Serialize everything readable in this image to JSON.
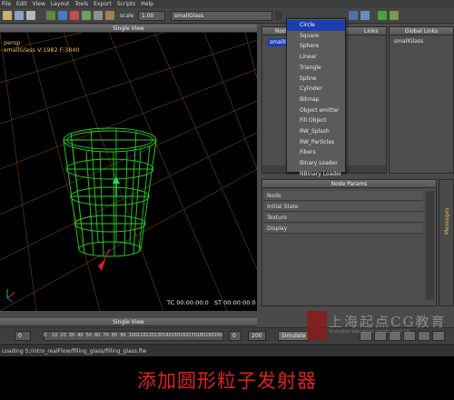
{
  "menu": [
    "File",
    "Edit",
    "View",
    "Layout",
    "Tools",
    "Export",
    "Scripts",
    "Help"
  ],
  "toolbar": {
    "scale_label": "scale",
    "scale_value": "1.00",
    "node_name": "smallGlass"
  },
  "viewport": {
    "title": "Single View",
    "camera": "persp",
    "info": "smallGlass V:1982 F:3840",
    "timecode": "TC 00:00:00:0",
    "start_time": "ST 00:00:00:0"
  },
  "node_panel": {
    "title": "Node",
    "links_title": "Links",
    "selected_node": "smallG"
  },
  "global_panel": {
    "title": "Global Links",
    "item": "smallGlass"
  },
  "dropdown": {
    "items": [
      "Circle",
      "Square",
      "Sphere",
      "Linear",
      "Triangle",
      "Spline",
      "Cylinder",
      "Bitmap",
      "Object emitter",
      "Fill Object",
      "RW_Splash",
      "RW_Particles",
      "Fibers",
      "Binary Loader",
      "NBinary Loader"
    ],
    "selected_index": 0
  },
  "params": {
    "title": "Node Params",
    "rows": [
      "Node",
      "Initial State",
      "Texture",
      "Display"
    ]
  },
  "messages_label": "Messages",
  "bottom_view_title": "Single View",
  "timeline": {
    "start": "0",
    "current": "0",
    "ticks": [
      "10",
      "20",
      "30",
      "40",
      "50",
      "60",
      "70",
      "80",
      "90",
      "100",
      "110",
      "120",
      "130",
      "140",
      "150",
      "160",
      "170",
      "180",
      "190",
      "200"
    ],
    "end_a": "0",
    "end_b": "200",
    "simulate_label": "Simulate"
  },
  "status": "Loading S:/intro_realFlow/filling_glass/filling_glass.flw",
  "watermark": {
    "brand": "上海起点CG教育",
    "subtitle": "Shanghai education center start CG"
  },
  "caption": "添加圆形粒子发射器"
}
